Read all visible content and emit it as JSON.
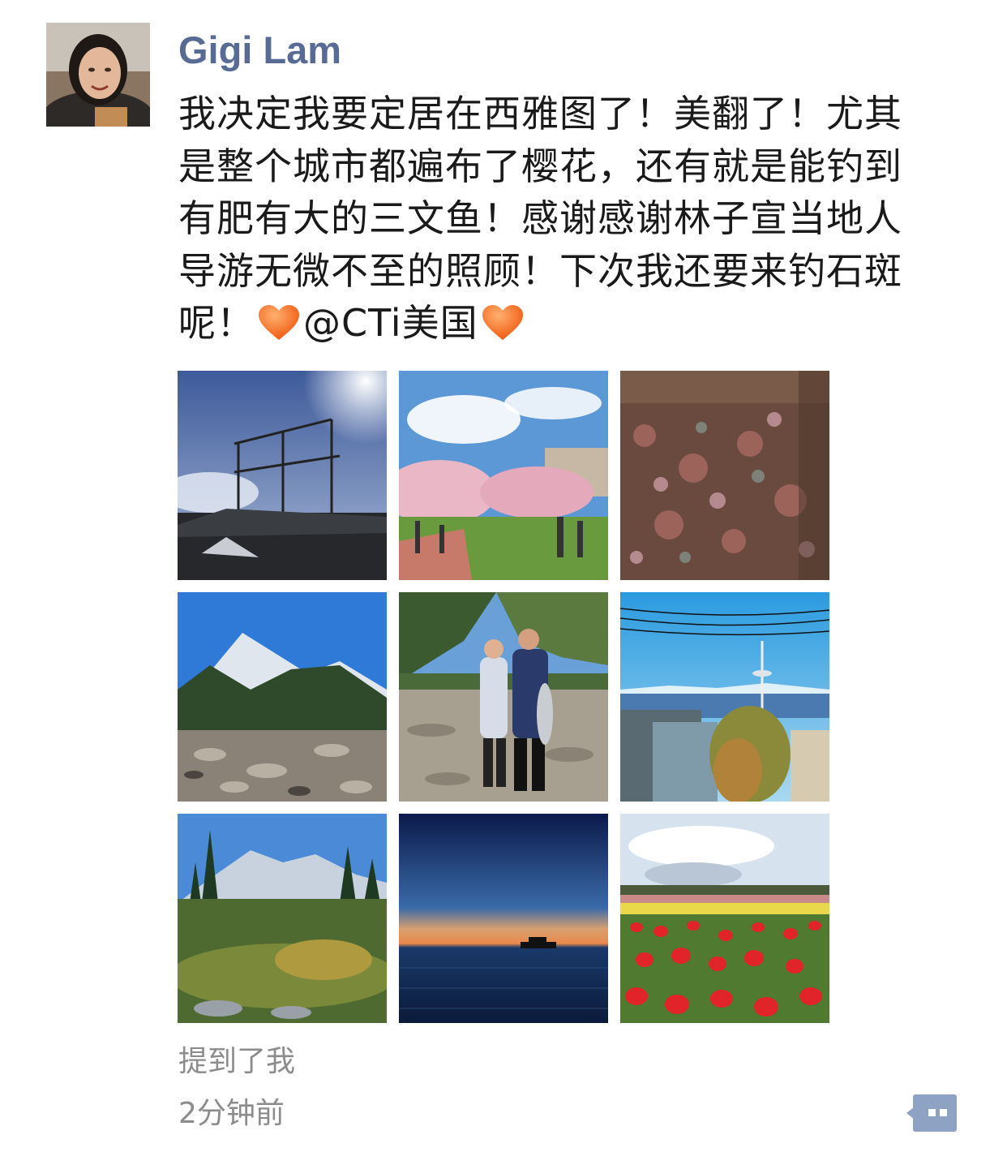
{
  "post": {
    "author": "Gigi Lam",
    "text_before_first_heart": "我决定我要定居在西雅图了！美翻了！尤其是整个城市都遍布了樱花，还有就是能钓到有肥有大的三文鱼！感谢感谢林子宣当地人导游无微不至的照顾！下次我还要来钓石斑呢！",
    "mention": "@CTi美国",
    "mentions_me": "提到了我",
    "timestamp": "2分钟前",
    "accent_color": "#576b95",
    "heart_color": "#f26a1b",
    "photos": [
      "Pike Place Public Market sign",
      "Cherry blossoms on campus quad",
      "Gum wall",
      "Mountain river valley",
      "Two people holding a salmon on the beach",
      "Space Needle skyline",
      "Alpine meadow with mountain",
      "Sunset over water with ferry",
      "Tulip field"
    ]
  },
  "icons": {
    "avatar": "user-avatar-photo",
    "heart": "orange-heart-emoji",
    "comment": "comment-bubble-icon"
  }
}
